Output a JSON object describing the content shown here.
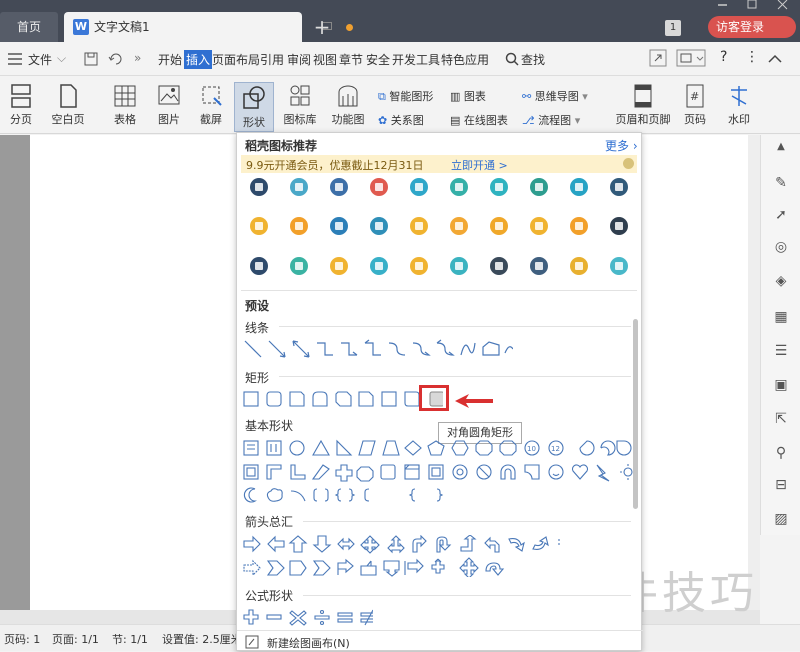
{
  "titlebar": {
    "home_tab": "首页",
    "doc_tab": "文字文稿1",
    "new_tab": "+",
    "window_badge": "1",
    "login": "访客登录"
  },
  "menubar": {
    "file": "文件",
    "items": [
      "开始",
      "插入",
      "页面布局",
      "引用",
      "审阅",
      "视图",
      "章节",
      "安全",
      "开发工具",
      "特色应用"
    ],
    "active": "插入",
    "search": "查找"
  },
  "toolbar": {
    "page_break": "分页",
    "blank_page": "空白页",
    "table": "表格",
    "picture": "图片",
    "screenshot": "截屏",
    "shape": "形状",
    "icon_lib": "图标库",
    "function_chart": "功能图",
    "smart_art": "智能图形",
    "chart": "图表",
    "mind_map": "思维导图",
    "relation": "关系图",
    "online_chart": "在线图表",
    "flowchart": "流程图",
    "header_footer": "页眉和页脚",
    "page_num": "页码",
    "watermark": "水印"
  },
  "panel": {
    "title": "稻壳图标推荐",
    "more": "更多",
    "promo_text": "9.9元开通会员，优惠截止12月31日",
    "promo_link": "立即开通 >",
    "preset": "预设",
    "lines": "线条",
    "rect": "矩形",
    "basic": "基本形状",
    "arrows": "箭头总汇",
    "formula": "公式形状",
    "tooltip": "对角圆角矩形",
    "new_canvas": "新建绘图画布(N)"
  },
  "statusbar": {
    "page": "页码: 1",
    "pages": "页面: 1/1",
    "section": "节: 1/1",
    "setting": "设置值: 2.5厘米"
  },
  "watermark_text": "软件技巧",
  "colors": {
    "accent": "#2f6fd1",
    "highlight": "#d93030",
    "titlebar": "#444a56"
  }
}
